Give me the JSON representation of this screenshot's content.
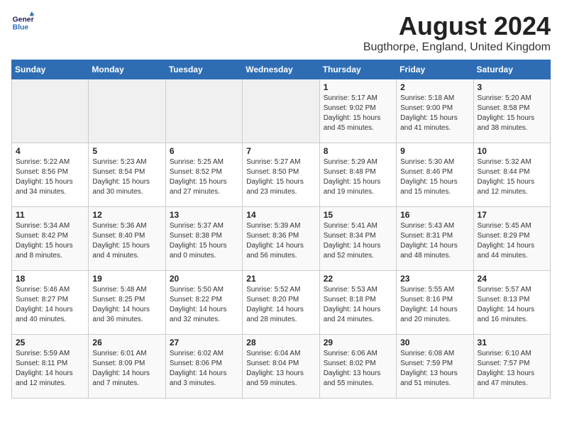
{
  "logo": {
    "line1": "General",
    "line2": "Blue"
  },
  "title": "August 2024",
  "location": "Bugthorpe, England, United Kingdom",
  "days_of_week": [
    "Sunday",
    "Monday",
    "Tuesday",
    "Wednesday",
    "Thursday",
    "Friday",
    "Saturday"
  ],
  "weeks": [
    [
      {
        "day": "",
        "info": ""
      },
      {
        "day": "",
        "info": ""
      },
      {
        "day": "",
        "info": ""
      },
      {
        "day": "",
        "info": ""
      },
      {
        "day": "1",
        "info": "Sunrise: 5:17 AM\nSunset: 9:02 PM\nDaylight: 15 hours\nand 45 minutes."
      },
      {
        "day": "2",
        "info": "Sunrise: 5:18 AM\nSunset: 9:00 PM\nDaylight: 15 hours\nand 41 minutes."
      },
      {
        "day": "3",
        "info": "Sunrise: 5:20 AM\nSunset: 8:58 PM\nDaylight: 15 hours\nand 38 minutes."
      }
    ],
    [
      {
        "day": "4",
        "info": "Sunrise: 5:22 AM\nSunset: 8:56 PM\nDaylight: 15 hours\nand 34 minutes."
      },
      {
        "day": "5",
        "info": "Sunrise: 5:23 AM\nSunset: 8:54 PM\nDaylight: 15 hours\nand 30 minutes."
      },
      {
        "day": "6",
        "info": "Sunrise: 5:25 AM\nSunset: 8:52 PM\nDaylight: 15 hours\nand 27 minutes."
      },
      {
        "day": "7",
        "info": "Sunrise: 5:27 AM\nSunset: 8:50 PM\nDaylight: 15 hours\nand 23 minutes."
      },
      {
        "day": "8",
        "info": "Sunrise: 5:29 AM\nSunset: 8:48 PM\nDaylight: 15 hours\nand 19 minutes."
      },
      {
        "day": "9",
        "info": "Sunrise: 5:30 AM\nSunset: 8:46 PM\nDaylight: 15 hours\nand 15 minutes."
      },
      {
        "day": "10",
        "info": "Sunrise: 5:32 AM\nSunset: 8:44 PM\nDaylight: 15 hours\nand 12 minutes."
      }
    ],
    [
      {
        "day": "11",
        "info": "Sunrise: 5:34 AM\nSunset: 8:42 PM\nDaylight: 15 hours\nand 8 minutes."
      },
      {
        "day": "12",
        "info": "Sunrise: 5:36 AM\nSunset: 8:40 PM\nDaylight: 15 hours\nand 4 minutes."
      },
      {
        "day": "13",
        "info": "Sunrise: 5:37 AM\nSunset: 8:38 PM\nDaylight: 15 hours\nand 0 minutes."
      },
      {
        "day": "14",
        "info": "Sunrise: 5:39 AM\nSunset: 8:36 PM\nDaylight: 14 hours\nand 56 minutes."
      },
      {
        "day": "15",
        "info": "Sunrise: 5:41 AM\nSunset: 8:34 PM\nDaylight: 14 hours\nand 52 minutes."
      },
      {
        "day": "16",
        "info": "Sunrise: 5:43 AM\nSunset: 8:31 PM\nDaylight: 14 hours\nand 48 minutes."
      },
      {
        "day": "17",
        "info": "Sunrise: 5:45 AM\nSunset: 8:29 PM\nDaylight: 14 hours\nand 44 minutes."
      }
    ],
    [
      {
        "day": "18",
        "info": "Sunrise: 5:46 AM\nSunset: 8:27 PM\nDaylight: 14 hours\nand 40 minutes."
      },
      {
        "day": "19",
        "info": "Sunrise: 5:48 AM\nSunset: 8:25 PM\nDaylight: 14 hours\nand 36 minutes."
      },
      {
        "day": "20",
        "info": "Sunrise: 5:50 AM\nSunset: 8:22 PM\nDaylight: 14 hours\nand 32 minutes."
      },
      {
        "day": "21",
        "info": "Sunrise: 5:52 AM\nSunset: 8:20 PM\nDaylight: 14 hours\nand 28 minutes."
      },
      {
        "day": "22",
        "info": "Sunrise: 5:53 AM\nSunset: 8:18 PM\nDaylight: 14 hours\nand 24 minutes."
      },
      {
        "day": "23",
        "info": "Sunrise: 5:55 AM\nSunset: 8:16 PM\nDaylight: 14 hours\nand 20 minutes."
      },
      {
        "day": "24",
        "info": "Sunrise: 5:57 AM\nSunset: 8:13 PM\nDaylight: 14 hours\nand 16 minutes."
      }
    ],
    [
      {
        "day": "25",
        "info": "Sunrise: 5:59 AM\nSunset: 8:11 PM\nDaylight: 14 hours\nand 12 minutes."
      },
      {
        "day": "26",
        "info": "Sunrise: 6:01 AM\nSunset: 8:09 PM\nDaylight: 14 hours\nand 7 minutes."
      },
      {
        "day": "27",
        "info": "Sunrise: 6:02 AM\nSunset: 8:06 PM\nDaylight: 14 hours\nand 3 minutes."
      },
      {
        "day": "28",
        "info": "Sunrise: 6:04 AM\nSunset: 8:04 PM\nDaylight: 13 hours\nand 59 minutes."
      },
      {
        "day": "29",
        "info": "Sunrise: 6:06 AM\nSunset: 8:02 PM\nDaylight: 13 hours\nand 55 minutes."
      },
      {
        "day": "30",
        "info": "Sunrise: 6:08 AM\nSunset: 7:59 PM\nDaylight: 13 hours\nand 51 minutes."
      },
      {
        "day": "31",
        "info": "Sunrise: 6:10 AM\nSunset: 7:57 PM\nDaylight: 13 hours\nand 47 minutes."
      }
    ]
  ]
}
